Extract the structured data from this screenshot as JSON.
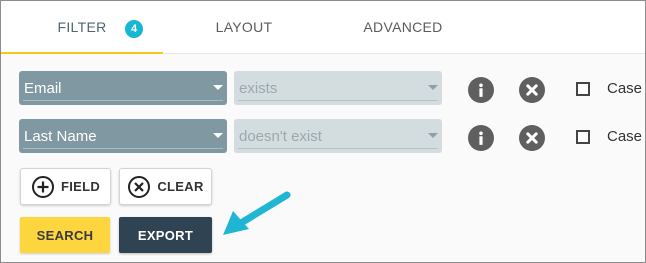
{
  "tabs": [
    {
      "label": "FILTER",
      "badge": "4",
      "active": true
    },
    {
      "label": "LAYOUT",
      "active": false
    },
    {
      "label": "ADVANCED",
      "active": false
    }
  ],
  "filters": [
    {
      "field": "Email",
      "condition": "exists",
      "case_label": "Case",
      "case_checked": false
    },
    {
      "field": "Last Name",
      "condition": "doesn't exist",
      "case_label": "Case",
      "case_checked": false
    }
  ],
  "buttons": {
    "add_field": "FIELD",
    "clear": "CLEAR",
    "search": "SEARCH",
    "export": "EXPORT"
  },
  "icons": {
    "info": "info-icon",
    "remove": "remove-circle-icon",
    "add": "plus-circle-icon",
    "clear": "x-circle-icon",
    "annotation_arrow": "arrow-icon"
  },
  "colors": {
    "tab_active_underline": "#f4c816",
    "badge": "#17b7d4",
    "field_select": "#7f98a2",
    "condition_select": "#d3dcdf",
    "search_button": "#fcd53f",
    "export_button": "#2f4352",
    "annotation_arrow": "#1fb6d4"
  }
}
